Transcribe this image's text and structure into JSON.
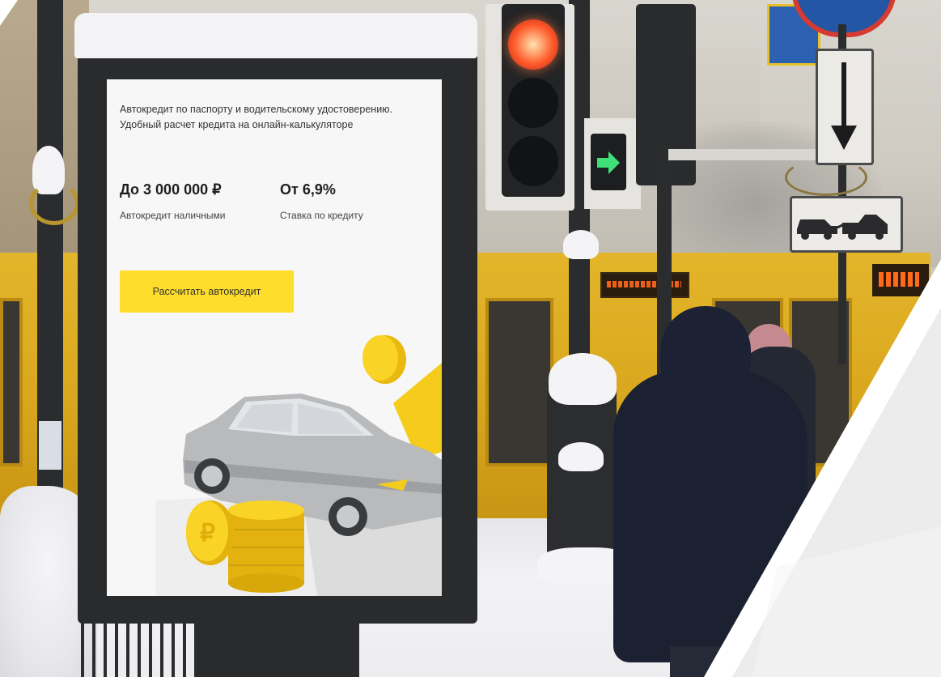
{
  "poster": {
    "subtitle_line1": "Автокредит по паспорту и водительскому удостоверению.",
    "subtitle_line2": "Удобный расчет кредита на онлайн-калькуляторе",
    "stat_amount_value": "До 3 000 000 ₽",
    "stat_amount_label": "Автокредит наличными",
    "stat_rate_value": "От 6,9%",
    "stat_rate_label": "Ставка по кредиту",
    "cta_label": "Рассчитать автокредит",
    "accent_color": "#ffdd2d"
  },
  "icons": {
    "traffic_light_arrow": "right-arrow-icon",
    "road_sign_arrow": "down-arrow-icon",
    "tow_sign": "tow-truck-icon"
  }
}
